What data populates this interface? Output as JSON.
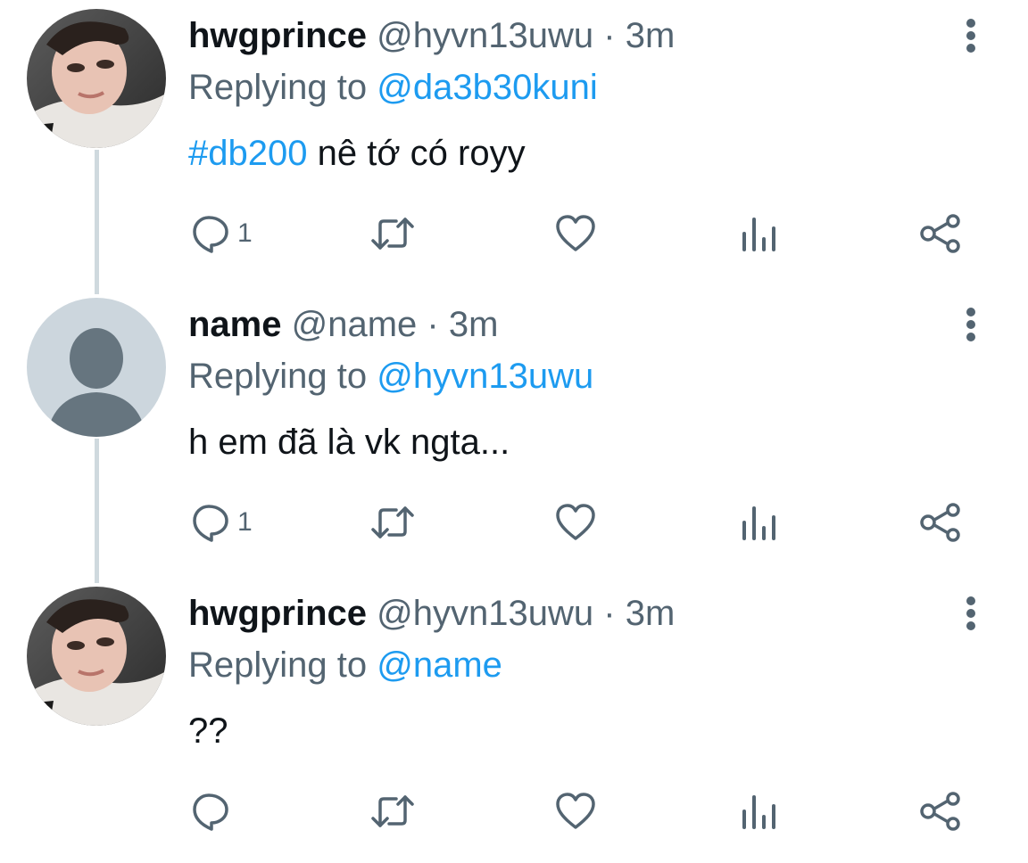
{
  "tweets": [
    {
      "display_name": "hwgprince",
      "handle": "@hyvn13uwu",
      "separator": "·",
      "time": "3m",
      "replying_prefix": "Replying to",
      "replying_to": "@da3b30kuni",
      "hashtag": "#db200",
      "text": " nê tớ có royy",
      "reply_count": "1",
      "avatar": "photo-avatar"
    },
    {
      "display_name": "name",
      "handle": "@name",
      "separator": "·",
      "time": "3m",
      "replying_prefix": "Replying to",
      "replying_to": "@hyvn13uwu",
      "text": "h em đã là vk ngta...",
      "reply_count": "1",
      "avatar": "default-avatar"
    },
    {
      "display_name": "hwgprince",
      "handle": "@hyvn13uwu",
      "separator": "·",
      "time": "3m",
      "replying_prefix": "Replying to",
      "replying_to": "@name",
      "text": "??",
      "reply_count": "",
      "avatar": "photo-avatar"
    }
  ],
  "icons": {
    "reply": "reply-icon",
    "retweet": "retweet-icon",
    "like": "heart-icon",
    "views": "analytics-icon",
    "share": "share-icon",
    "more": "more-vertical-icon"
  },
  "colors": {
    "link": "#1d9bf0",
    "secondary_text": "#536471",
    "primary_text": "#0f1419",
    "thread_line": "#cfd9de",
    "default_avatar_bg": "#ccd6dd",
    "default_avatar_fg": "#66757f"
  }
}
